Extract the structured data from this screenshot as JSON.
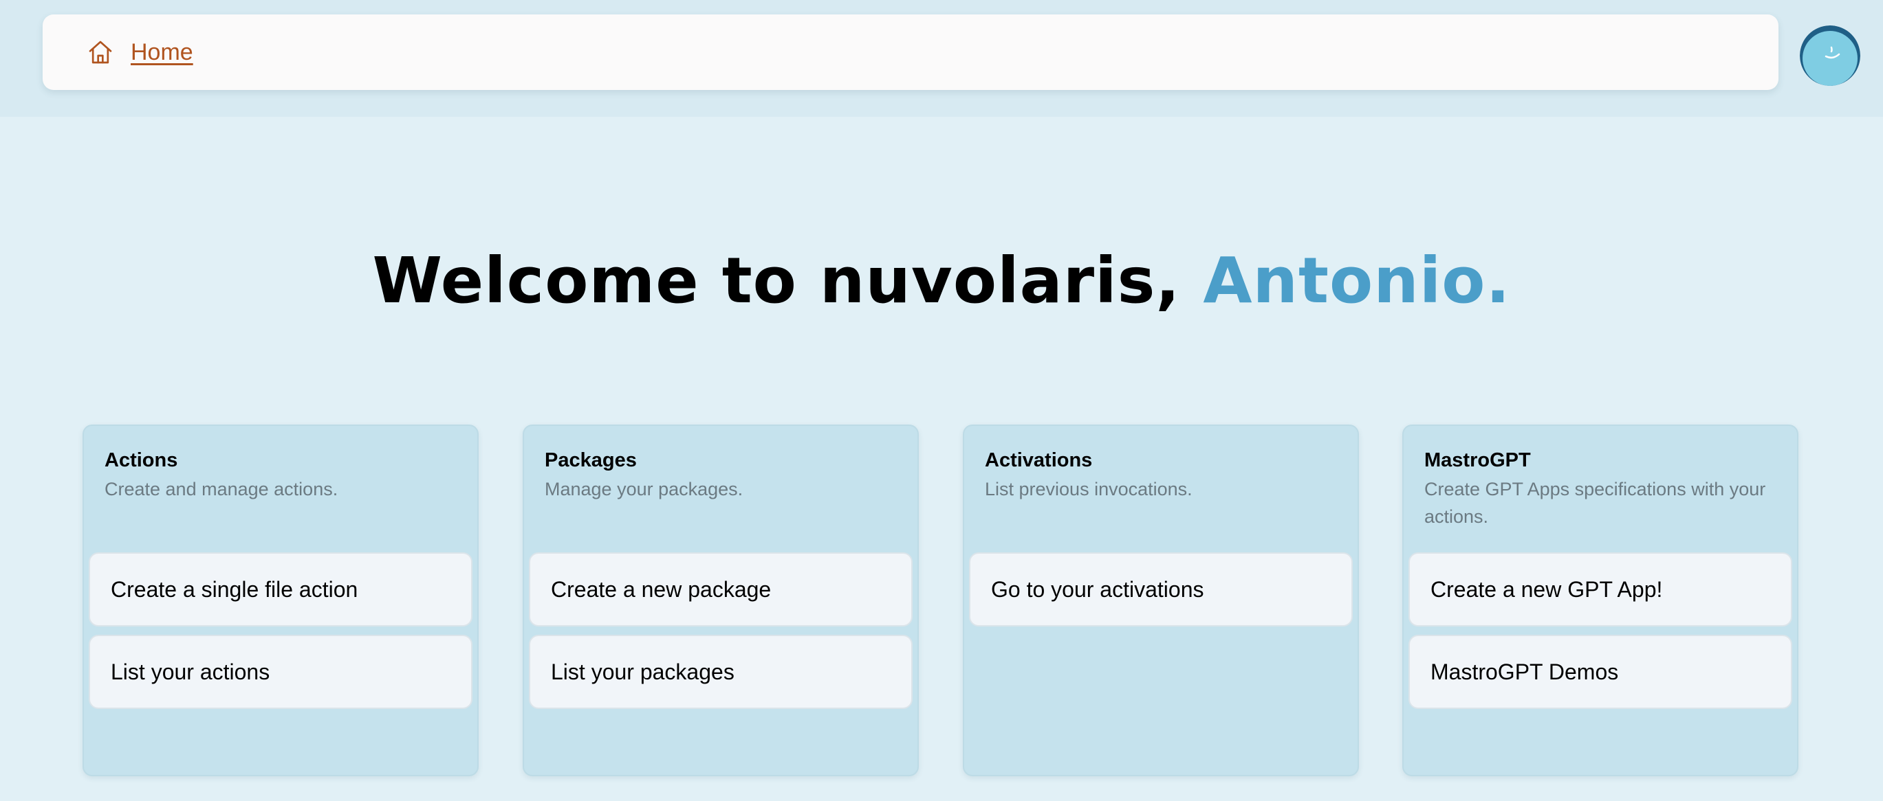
{
  "navbar": {
    "home_label": "Home",
    "home_icon": "home-icon",
    "accent_color": "#b0541f"
  },
  "avatar": {
    "icon": "smiling-cloud-avatar",
    "color": "#7fcde3"
  },
  "welcome": {
    "prefix": "Welcome to nuvolaris, ",
    "name": "Antonio.",
    "name_color": "#4b9ec9"
  },
  "cards": [
    {
      "title": "Actions",
      "description": "Create and manage actions.",
      "buttons": [
        "Create a single file action",
        "List your actions"
      ]
    },
    {
      "title": "Packages",
      "description": "Manage your packages.",
      "buttons": [
        "Create a new package",
        "List your packages"
      ]
    },
    {
      "title": "Activations",
      "description": "List previous invocations.",
      "buttons": [
        "Go to your activations"
      ]
    },
    {
      "title": "MastroGPT",
      "description": "Create GPT Apps specifications with your actions.",
      "buttons": [
        "Create a new GPT App!",
        "MastroGPT Demos"
      ]
    }
  ]
}
